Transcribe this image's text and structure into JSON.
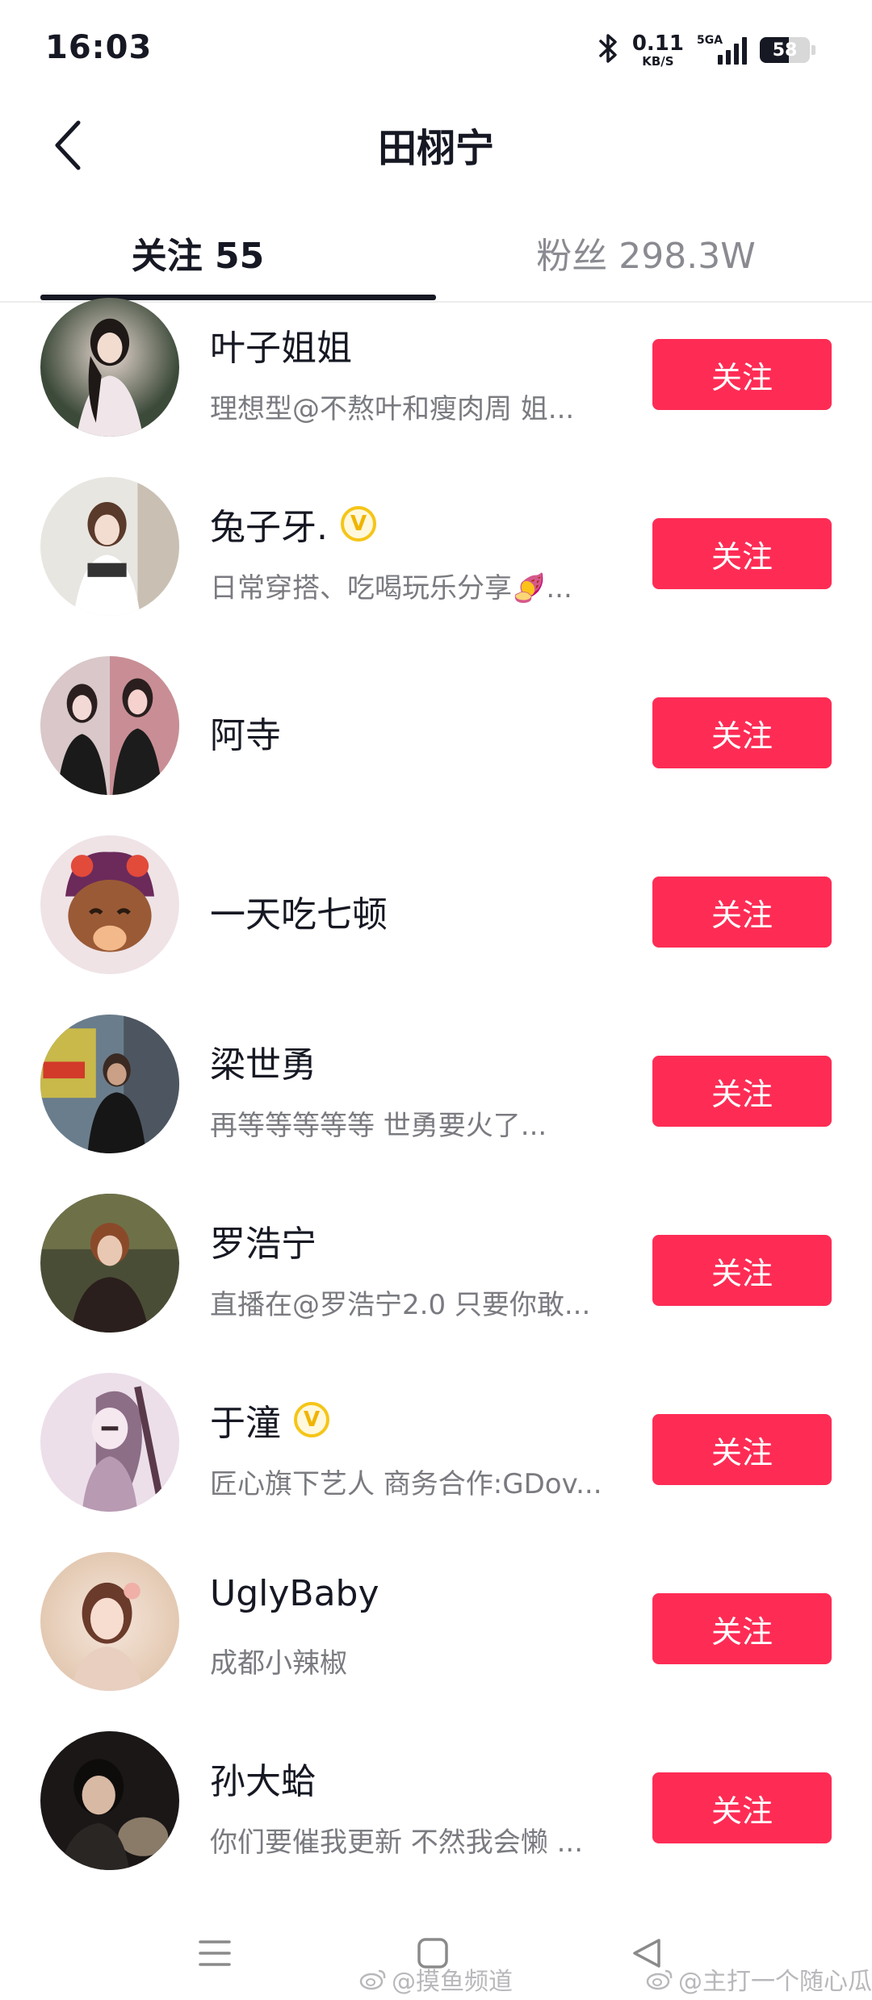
{
  "status_bar": {
    "time": "16:03",
    "net_speed_value": "0.11",
    "net_speed_unit": "KB/S",
    "network_type": "5GA",
    "battery": "58"
  },
  "header": {
    "title": "田栩宁"
  },
  "tabs": [
    {
      "label": "关注 55",
      "active": true
    },
    {
      "label": "粉丝 298.3W",
      "active": false
    }
  ],
  "users": [
    {
      "name": "叶子姐姐",
      "desc": "理想型@不熬叶和瘦肉周 姐...",
      "verified": false,
      "button": "关注",
      "avatar_icon": "avatar-photo"
    },
    {
      "name": "兔子牙.",
      "desc": "日常穿搭、吃喝玩乐分享🍠...",
      "verified": true,
      "button": "关注",
      "avatar_icon": "avatar-photo"
    },
    {
      "name": "阿寺",
      "desc": "",
      "verified": false,
      "button": "关注",
      "avatar_icon": "avatar-photo"
    },
    {
      "name": "一天吃七顿",
      "desc": "",
      "verified": false,
      "button": "关注",
      "avatar_icon": "avatar-cartoon"
    },
    {
      "name": "梁世勇",
      "desc": "再等等等等等 世勇要火了...",
      "verified": false,
      "button": "关注",
      "avatar_icon": "avatar-photo"
    },
    {
      "name": "罗浩宁",
      "desc": "直播在@罗浩宁2.0 只要你敢...",
      "verified": false,
      "button": "关注",
      "avatar_icon": "avatar-photo"
    },
    {
      "name": "于潼",
      "desc": "匠心旗下艺人 商务合作:GDov...",
      "verified": true,
      "button": "关注",
      "avatar_icon": "avatar-illustration"
    },
    {
      "name": "UglyBaby",
      "desc": "成都小辣椒",
      "verified": false,
      "button": "关注",
      "avatar_icon": "avatar-photo"
    },
    {
      "name": "孙大蛤",
      "desc": "你们要催我更新 不然我会懒 ...",
      "verified": false,
      "button": "关注",
      "avatar_icon": "avatar-photo"
    }
  ],
  "watermarks": [
    "@摸鱼频道",
    "@主打一个随心瓜"
  ],
  "colors": {
    "follow_button": "#fe2c55",
    "text_primary": "#161823",
    "text_secondary": "#7a7b80",
    "verified": "#f5c518"
  }
}
